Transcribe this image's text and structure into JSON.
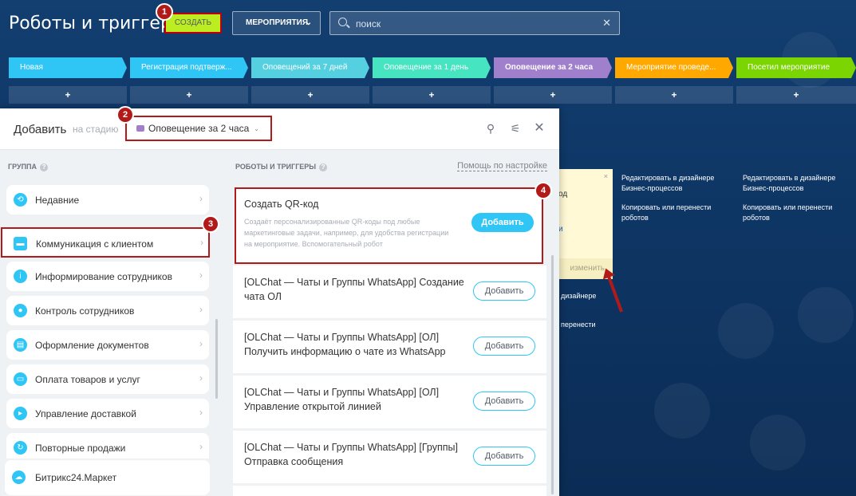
{
  "header": {
    "title": "Роботы и триггеры",
    "create_label": "СОЗДАТЬ",
    "events_label": "МЕРОПРИЯТИЯ",
    "search_placeholder": "поиск"
  },
  "stages": [
    {
      "label": "Новая",
      "color": "#2fc6f6"
    },
    {
      "label": "Регистрация подтверж...",
      "color": "#2fc6f6"
    },
    {
      "label": "Оповещений за 7 дней",
      "color": "#55d0e0"
    },
    {
      "label": "Оповещение за 1 день",
      "color": "#47e4c2"
    },
    {
      "label": "Оповещение за 2 часа",
      "color": "#a07fcc"
    },
    {
      "label": "Мероприятие проведе...",
      "color": "#ffa900"
    },
    {
      "label": "Посетил мероприятие",
      "color": "#7bd500"
    }
  ],
  "plus_label": "+",
  "badges": [
    "1",
    "2",
    "3",
    "4"
  ],
  "background_card": {
    "change_label": "изменить",
    "close": "×",
    "partial_title": "од",
    "partial_link": "и"
  },
  "background_links": [
    "Редактировать в дизайнере Бизнес-процессов",
    "Копировать или перенести роботов",
    "Редактировать в дизайнере Бизнес-процессов",
    "Копировать или перенести роботов",
    "дизайнере",
    "перенести"
  ],
  "panel": {
    "title": "Добавить",
    "subtitle": "на стадию",
    "stage_selected": "Оповещение за 2 часа",
    "group_label": "ГРУППА",
    "robots_label": "РОБОТЫ И ТРИГГЕРЫ",
    "help_link": "Помощь по настройке",
    "groups": [
      {
        "label": "Недавние",
        "icon": "clock-icon"
      },
      {
        "label": "Коммуникация с клиентом",
        "icon": "chat-icon"
      },
      {
        "label": "Информирование сотрудников",
        "icon": "info-icon"
      },
      {
        "label": "Контроль сотрудников",
        "icon": "people-icon"
      },
      {
        "label": "Оформление документов",
        "icon": "document-icon"
      },
      {
        "label": "Оплата товаров и услуг",
        "icon": "payment-icon"
      },
      {
        "label": "Управление доставкой",
        "icon": "truck-icon"
      },
      {
        "label": "Повторные продажи",
        "icon": "repeat-icon"
      }
    ],
    "market_label": "Битрикс24.Маркет",
    "items": [
      {
        "title": "Создать QR-код",
        "desc": "Создаёт персонализированные QR-коды под любые маркетинговые задачи, например, для удобства регистрации на мероприятие. Вспомогательный робот",
        "button": "Добавить"
      },
      {
        "title": "[OLChat — Чаты и Группы WhatsApp] Создание чата ОЛ",
        "button": "Добавить"
      },
      {
        "title": "[OLChat — Чаты и Группы WhatsApp] [ОЛ] Получить информацию о чате из WhatsApp",
        "button": "Добавить"
      },
      {
        "title": "[OLChat — Чаты и Группы WhatsApp] [ОЛ] Управление открытой линией",
        "button": "Добавить"
      },
      {
        "title": "[OLChat — Чаты и Группы WhatsApp] [Группы] Отправка сообщения",
        "button": "Добавить"
      }
    ]
  }
}
